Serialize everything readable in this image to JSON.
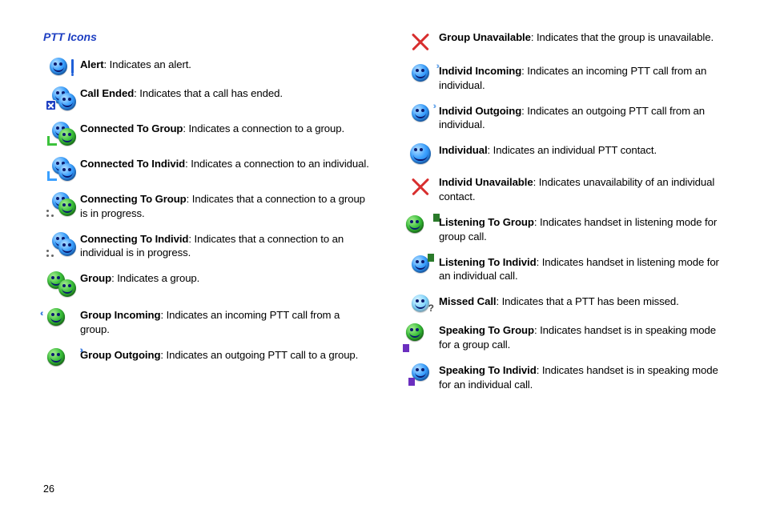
{
  "heading": "PTT Icons",
  "page_number": "26",
  "left": [
    {
      "term": "Alert",
      "desc": ": Indicates an alert."
    },
    {
      "term": "Call Ended",
      "desc": ": Indicates that a call has ended."
    },
    {
      "term": "Connected To Group",
      "desc": ": Indicates a connection to a group."
    },
    {
      "term": "Connected To Individ",
      "desc": ": Indicates a connection to an individual."
    },
    {
      "term": "Connecting To Group",
      "desc": ": Indicates that a connection to a group is in progress."
    },
    {
      "term": "Connecting To Individ",
      "desc": ": Indicates that a connection to an individual is in progress."
    },
    {
      "term": "Group",
      "desc": ": Indicates a group."
    },
    {
      "term": "Group Incoming",
      "desc": ": Indicates an incoming PTT call from a group."
    },
    {
      "term": "Group Outgoing",
      "desc": ": Indicates an outgoing PTT call to a group."
    }
  ],
  "right": [
    {
      "term": "Group Unavailable",
      "desc": ": Indicates that the group is unavailable."
    },
    {
      "term": "Individ Incoming",
      "desc": ": Indicates an incoming PTT call from an individual."
    },
    {
      "term": "Individ Outgoing",
      "desc": ": Indicates an outgoing PTT call from an individual."
    },
    {
      "term": "Individual",
      "desc": ": Indicates an individual PTT contact."
    },
    {
      "term": "Individ Unavailable",
      "desc": ": Indicates unavailability of an individual contact."
    },
    {
      "term": "Listening To Group",
      "desc": ": Indicates handset in listening mode for group call."
    },
    {
      "term": "Listening To Individ",
      "desc": ": Indicates handset in listening mode for an individual call."
    },
    {
      "term": "Missed Call",
      "desc": ": Indicates that a PTT has been missed."
    },
    {
      "term": "Speaking To Group",
      "desc": ": Indicates handset is in speaking mode for a group call."
    },
    {
      "term": "Speaking To Individ",
      "desc": ": Indicates handset is in speaking mode for an individual call."
    }
  ]
}
